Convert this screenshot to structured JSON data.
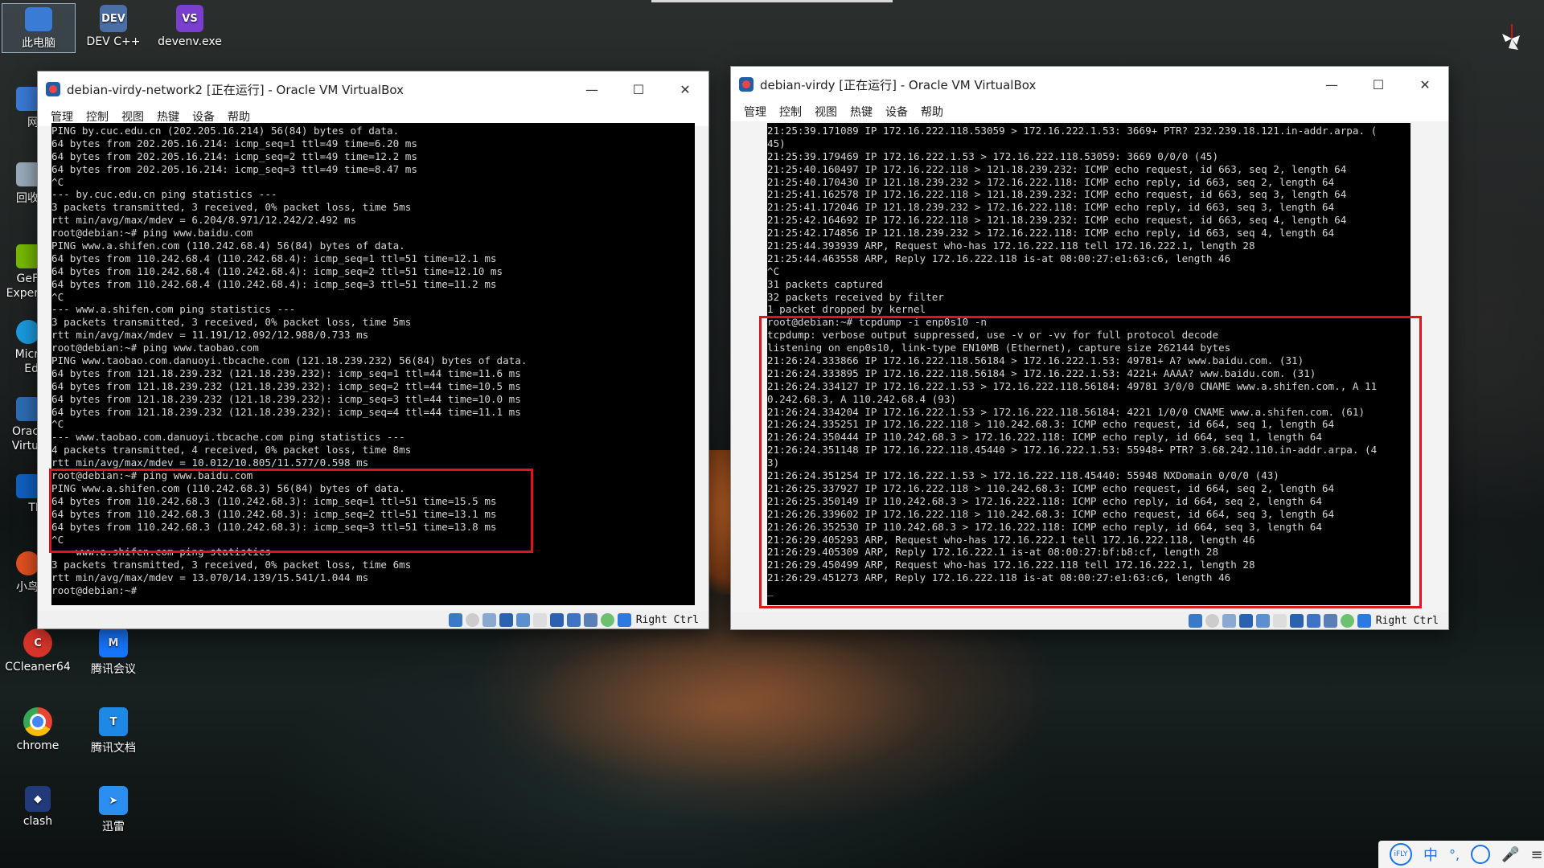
{
  "desktop": {
    "icons": [
      {
        "label": "此电脑",
        "icon": "computer-icon",
        "color": "#3a7bd5"
      },
      {
        "label": "DEV C++",
        "icon": "devcpp-icon",
        "color": "#4a6fa5"
      },
      {
        "label": "devenv.exe",
        "icon": "visual-studio-icon",
        "color": "#7b3fd0"
      },
      {
        "label": "CCleaner64",
        "icon": "ccleaner-icon",
        "color": "#d8342a"
      },
      {
        "label": "腾讯会议",
        "icon": "tencent-meeting-icon",
        "color": "#1677ff"
      },
      {
        "label": "chrome",
        "icon": "chrome-icon",
        "color": "#34a853"
      },
      {
        "label": "腾讯文档",
        "icon": "tencent-docs-icon",
        "color": "#1e88e5"
      },
      {
        "label": "clash",
        "icon": "clash-icon",
        "color": "#233a7a"
      },
      {
        "label": "迅雷",
        "icon": "xunlei-icon",
        "color": "#2b8ef0"
      }
    ],
    "partial_icons": [
      {
        "label": "网"
      },
      {
        "label": "回收"
      },
      {
        "label": "GeF Exper"
      },
      {
        "label": "Micr Ed"
      },
      {
        "label": "Orac Virtu"
      },
      {
        "label": "TI"
      },
      {
        "label": "小鸟"
      }
    ]
  },
  "vm_left": {
    "title": "debian-virdy-network2 [正在运行] - Oracle VM VirtualBox",
    "menu": [
      "管理",
      "控制",
      "视图",
      "热键",
      "设备",
      "帮助"
    ],
    "host_key": "Right Ctrl",
    "terminal_lines": [
      "PING by.cuc.edu.cn (202.205.16.214) 56(84) bytes of data.",
      "64 bytes from 202.205.16.214: icmp_seq=1 ttl=49 time=6.20 ms",
      "64 bytes from 202.205.16.214: icmp_seq=2 ttl=49 time=12.2 ms",
      "64 bytes from 202.205.16.214: icmp_seq=3 ttl=49 time=8.47 ms",
      "^C",
      "--- by.cuc.edu.cn ping statistics ---",
      "3 packets transmitted, 3 received, 0% packet loss, time 5ms",
      "rtt min/avg/max/mdev = 6.204/8.971/12.242/2.492 ms",
      "root@debian:~# ping www.baidu.com",
      "PING www.a.shifen.com (110.242.68.4) 56(84) bytes of data.",
      "64 bytes from 110.242.68.4 (110.242.68.4): icmp_seq=1 ttl=51 time=12.1 ms",
      "64 bytes from 110.242.68.4 (110.242.68.4): icmp_seq=2 ttl=51 time=12.10 ms",
      "64 bytes from 110.242.68.4 (110.242.68.4): icmp_seq=3 ttl=51 time=11.2 ms",
      "^C",
      "--- www.a.shifen.com ping statistics ---",
      "3 packets transmitted, 3 received, 0% packet loss, time 5ms",
      "rtt min/avg/max/mdev = 11.191/12.092/12.988/0.733 ms",
      "root@debian:~# ping www.taobao.com",
      "PING www.taobao.com.danuoyi.tbcache.com (121.18.239.232) 56(84) bytes of data.",
      "64 bytes from 121.18.239.232 (121.18.239.232): icmp_seq=1 ttl=44 time=11.6 ms",
      "64 bytes from 121.18.239.232 (121.18.239.232): icmp_seq=2 ttl=44 time=10.5 ms",
      "64 bytes from 121.18.239.232 (121.18.239.232): icmp_seq=3 ttl=44 time=10.0 ms",
      "64 bytes from 121.18.239.232 (121.18.239.232): icmp_seq=4 ttl=44 time=11.1 ms",
      "^C",
      "--- www.taobao.com.danuoyi.tbcache.com ping statistics ---",
      "4 packets transmitted, 4 received, 0% packet loss, time 8ms",
      "rtt min/avg/max/mdev = 10.012/10.805/11.577/0.598 ms",
      "root@debian:~# ping www.baidu.com",
      "PING www.a.shifen.com (110.242.68.3) 56(84) bytes of data.",
      "64 bytes from 110.242.68.3 (110.242.68.3): icmp_seq=1 ttl=51 time=15.5 ms",
      "64 bytes from 110.242.68.3 (110.242.68.3): icmp_seq=2 ttl=51 time=13.1 ms",
      "64 bytes from 110.242.68.3 (110.242.68.3): icmp_seq=3 ttl=51 time=13.8 ms",
      "^C",
      "--- www.a.shifen.com ping statistics ---",
      "3 packets transmitted, 3 received, 0% packet loss, time 6ms",
      "rtt min/avg/max/mdev = 13.070/14.139/15.541/1.044 ms",
      "root@debian:~#"
    ]
  },
  "vm_right": {
    "title": "debian-virdy [正在运行] - Oracle VM VirtualBox",
    "menu": [
      "管理",
      "控制",
      "视图",
      "热键",
      "设备",
      "帮助"
    ],
    "host_key": "Right Ctrl",
    "terminal_lines": [
      "21:25:39.171089 IP 172.16.222.118.53059 > 172.16.222.1.53: 3669+ PTR? 232.239.18.121.in-addr.arpa. (",
      "45)",
      "21:25:39.179469 IP 172.16.222.1.53 > 172.16.222.118.53059: 3669 0/0/0 (45)",
      "21:25:40.160497 IP 172.16.222.118 > 121.18.239.232: ICMP echo request, id 663, seq 2, length 64",
      "21:25:40.170430 IP 121.18.239.232 > 172.16.222.118: ICMP echo reply, id 663, seq 2, length 64",
      "21:25:41.162578 IP 172.16.222.118 > 121.18.239.232: ICMP echo request, id 663, seq 3, length 64",
      "21:25:41.172046 IP 121.18.239.232 > 172.16.222.118: ICMP echo reply, id 663, seq 3, length 64",
      "21:25:42.164692 IP 172.16.222.118 > 121.18.239.232: ICMP echo request, id 663, seq 4, length 64",
      "21:25:42.174856 IP 121.18.239.232 > 172.16.222.118: ICMP echo reply, id 663, seq 4, length 64",
      "21:25:44.393939 ARP, Request who-has 172.16.222.118 tell 172.16.222.1, length 28",
      "21:25:44.463558 ARP, Reply 172.16.222.118 is-at 08:00:27:e1:63:c6, length 46",
      "^C",
      "31 packets captured",
      "32 packets received by filter",
      "1 packet dropped by kernel",
      "root@debian:~# tcpdump -i enp0s10 -n",
      "tcpdump: verbose output suppressed, use -v or -vv for full protocol decode",
      "listening on enp0s10, link-type EN10MB (Ethernet), capture size 262144 bytes",
      "21:26:24.333866 IP 172.16.222.118.56184 > 172.16.222.1.53: 49781+ A? www.baidu.com. (31)",
      "21:26:24.333895 IP 172.16.222.118.56184 > 172.16.222.1.53: 4221+ AAAA? www.baidu.com. (31)",
      "21:26:24.334127 IP 172.16.222.1.53 > 172.16.222.118.56184: 49781 3/0/0 CNAME www.a.shifen.com., A 11",
      "0.242.68.3, A 110.242.68.4 (93)",
      "21:26:24.334204 IP 172.16.222.1.53 > 172.16.222.118.56184: 4221 1/0/0 CNAME www.a.shifen.com. (61)",
      "21:26:24.335251 IP 172.16.222.118 > 110.242.68.3: ICMP echo request, id 664, seq 1, length 64",
      "21:26:24.350444 IP 110.242.68.3 > 172.16.222.118: ICMP echo reply, id 664, seq 1, length 64",
      "21:26:24.351148 IP 172.16.222.118.45440 > 172.16.222.1.53: 55948+ PTR? 3.68.242.110.in-addr.arpa. (4",
      "3)",
      "21:26:24.351254 IP 172.16.222.1.53 > 172.16.222.118.45440: 55948 NXDomain 0/0/0 (43)",
      "21:26:25.337927 IP 172.16.222.118 > 110.242.68.3: ICMP echo request, id 664, seq 2, length 64",
      "21:26:25.350149 IP 110.242.68.3 > 172.16.222.118: ICMP echo reply, id 664, seq 2, length 64",
      "21:26:26.339602 IP 172.16.222.118 > 110.242.68.3: ICMP echo request, id 664, seq 3, length 64",
      "21:26:26.352530 IP 110.242.68.3 > 172.16.222.118: ICMP echo reply, id 664, seq 3, length 64",
      "21:26:29.405293 ARP, Request who-has 172.16.222.1 tell 172.16.222.118, length 46",
      "21:26:29.405309 ARP, Reply 172.16.222.1 is-at 08:00:27:bf:b8:cf, length 28",
      "21:26:29.450499 ARP, Request who-has 172.16.222.118 tell 172.16.222.1, length 28",
      "21:26:29.451273 ARP, Reply 172.16.222.118 is-at 08:00:27:e1:63:c6, length 46",
      "_"
    ]
  },
  "tray": {
    "items": [
      {
        "icon": "ifly-icon",
        "text": ""
      },
      {
        "icon": "ime-chinese-mode",
        "text": "中"
      },
      {
        "icon": "punctuation-icon",
        "text": "°,"
      },
      {
        "icon": "ifly-voice-icon",
        "text": ""
      },
      {
        "icon": "microphone-icon",
        "text": ""
      },
      {
        "icon": "more-icon",
        "text": ""
      }
    ]
  },
  "colors": {
    "highlight": "#e0141c",
    "terminal_bg": "#000000",
    "terminal_fg": "#d6d6d6"
  }
}
